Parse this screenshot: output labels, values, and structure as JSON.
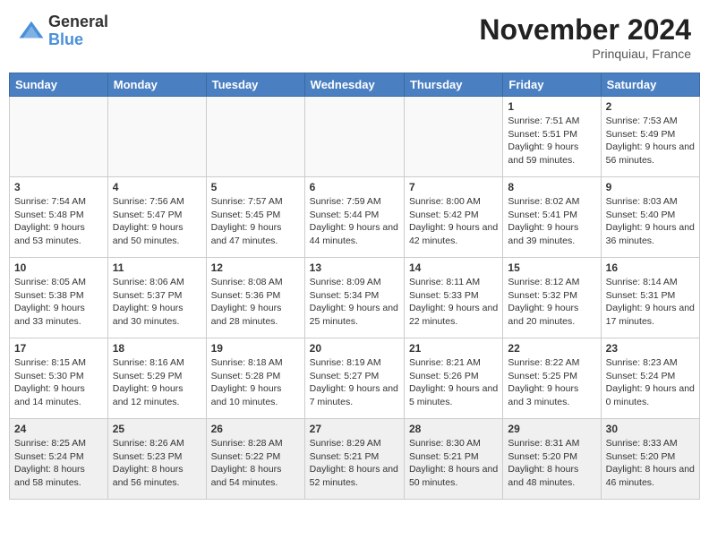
{
  "header": {
    "logo_general": "General",
    "logo_blue": "Blue",
    "month_title": "November 2024",
    "location": "Prinquiau, France"
  },
  "weekdays": [
    "Sunday",
    "Monday",
    "Tuesday",
    "Wednesday",
    "Thursday",
    "Friday",
    "Saturday"
  ],
  "weeks": [
    [
      {
        "day": "",
        "info": ""
      },
      {
        "day": "",
        "info": ""
      },
      {
        "day": "",
        "info": ""
      },
      {
        "day": "",
        "info": ""
      },
      {
        "day": "",
        "info": ""
      },
      {
        "day": "1",
        "info": "Sunrise: 7:51 AM\nSunset: 5:51 PM\nDaylight: 9 hours and 59 minutes."
      },
      {
        "day": "2",
        "info": "Sunrise: 7:53 AM\nSunset: 5:49 PM\nDaylight: 9 hours and 56 minutes."
      }
    ],
    [
      {
        "day": "3",
        "info": "Sunrise: 7:54 AM\nSunset: 5:48 PM\nDaylight: 9 hours and 53 minutes."
      },
      {
        "day": "4",
        "info": "Sunrise: 7:56 AM\nSunset: 5:47 PM\nDaylight: 9 hours and 50 minutes."
      },
      {
        "day": "5",
        "info": "Sunrise: 7:57 AM\nSunset: 5:45 PM\nDaylight: 9 hours and 47 minutes."
      },
      {
        "day": "6",
        "info": "Sunrise: 7:59 AM\nSunset: 5:44 PM\nDaylight: 9 hours and 44 minutes."
      },
      {
        "day": "7",
        "info": "Sunrise: 8:00 AM\nSunset: 5:42 PM\nDaylight: 9 hours and 42 minutes."
      },
      {
        "day": "8",
        "info": "Sunrise: 8:02 AM\nSunset: 5:41 PM\nDaylight: 9 hours and 39 minutes."
      },
      {
        "day": "9",
        "info": "Sunrise: 8:03 AM\nSunset: 5:40 PM\nDaylight: 9 hours and 36 minutes."
      }
    ],
    [
      {
        "day": "10",
        "info": "Sunrise: 8:05 AM\nSunset: 5:38 PM\nDaylight: 9 hours and 33 minutes."
      },
      {
        "day": "11",
        "info": "Sunrise: 8:06 AM\nSunset: 5:37 PM\nDaylight: 9 hours and 30 minutes."
      },
      {
        "day": "12",
        "info": "Sunrise: 8:08 AM\nSunset: 5:36 PM\nDaylight: 9 hours and 28 minutes."
      },
      {
        "day": "13",
        "info": "Sunrise: 8:09 AM\nSunset: 5:34 PM\nDaylight: 9 hours and 25 minutes."
      },
      {
        "day": "14",
        "info": "Sunrise: 8:11 AM\nSunset: 5:33 PM\nDaylight: 9 hours and 22 minutes."
      },
      {
        "day": "15",
        "info": "Sunrise: 8:12 AM\nSunset: 5:32 PM\nDaylight: 9 hours and 20 minutes."
      },
      {
        "day": "16",
        "info": "Sunrise: 8:14 AM\nSunset: 5:31 PM\nDaylight: 9 hours and 17 minutes."
      }
    ],
    [
      {
        "day": "17",
        "info": "Sunrise: 8:15 AM\nSunset: 5:30 PM\nDaylight: 9 hours and 14 minutes."
      },
      {
        "day": "18",
        "info": "Sunrise: 8:16 AM\nSunset: 5:29 PM\nDaylight: 9 hours and 12 minutes."
      },
      {
        "day": "19",
        "info": "Sunrise: 8:18 AM\nSunset: 5:28 PM\nDaylight: 9 hours and 10 minutes."
      },
      {
        "day": "20",
        "info": "Sunrise: 8:19 AM\nSunset: 5:27 PM\nDaylight: 9 hours and 7 minutes."
      },
      {
        "day": "21",
        "info": "Sunrise: 8:21 AM\nSunset: 5:26 PM\nDaylight: 9 hours and 5 minutes."
      },
      {
        "day": "22",
        "info": "Sunrise: 8:22 AM\nSunset: 5:25 PM\nDaylight: 9 hours and 3 minutes."
      },
      {
        "day": "23",
        "info": "Sunrise: 8:23 AM\nSunset: 5:24 PM\nDaylight: 9 hours and 0 minutes."
      }
    ],
    [
      {
        "day": "24",
        "info": "Sunrise: 8:25 AM\nSunset: 5:24 PM\nDaylight: 8 hours and 58 minutes."
      },
      {
        "day": "25",
        "info": "Sunrise: 8:26 AM\nSunset: 5:23 PM\nDaylight: 8 hours and 56 minutes."
      },
      {
        "day": "26",
        "info": "Sunrise: 8:28 AM\nSunset: 5:22 PM\nDaylight: 8 hours and 54 minutes."
      },
      {
        "day": "27",
        "info": "Sunrise: 8:29 AM\nSunset: 5:21 PM\nDaylight: 8 hours and 52 minutes."
      },
      {
        "day": "28",
        "info": "Sunrise: 8:30 AM\nSunset: 5:21 PM\nDaylight: 8 hours and 50 minutes."
      },
      {
        "day": "29",
        "info": "Sunrise: 8:31 AM\nSunset: 5:20 PM\nDaylight: 8 hours and 48 minutes."
      },
      {
        "day": "30",
        "info": "Sunrise: 8:33 AM\nSunset: 5:20 PM\nDaylight: 8 hours and 46 minutes."
      }
    ]
  ]
}
